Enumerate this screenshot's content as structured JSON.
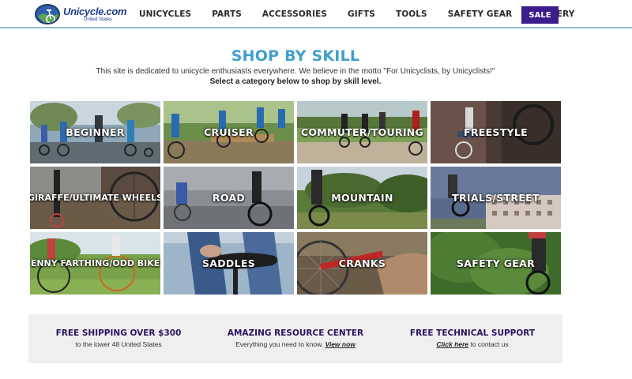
{
  "logo": {
    "name": "Unicycle.com",
    "sub": "United States"
  },
  "nav": {
    "items": [
      {
        "label": "UNICYCLES"
      },
      {
        "label": "PARTS"
      },
      {
        "label": "ACCESSORIES"
      },
      {
        "label": "GIFTS"
      },
      {
        "label": "TOOLS"
      },
      {
        "label": "SAFETY GEAR"
      },
      {
        "label": "GALLERY"
      }
    ],
    "sale_label": "SALE"
  },
  "intro": {
    "title": "SHOP BY SKILL",
    "line1": "This site is dedicated to unicycle enthusiasts everywhere. We believe in the motto \"For Unicyclists, by Unicyclists!\"",
    "line2": "Select a category below to shop by skill level."
  },
  "categories": [
    {
      "label": "BEGINNER"
    },
    {
      "label": "CRUISER"
    },
    {
      "label": "COMMUTER/TOURING"
    },
    {
      "label": "FREESTYLE"
    },
    {
      "label": "GIRAFFE/ULTIMATE WHEELS"
    },
    {
      "label": "ROAD"
    },
    {
      "label": "MOUNTAIN"
    },
    {
      "label": "TRIALS/STREET"
    },
    {
      "label": "PENNY FARTHING/ODD BIKES"
    },
    {
      "label": "SADDLES"
    },
    {
      "label": "CRANKS"
    },
    {
      "label": "SAFETY GEAR"
    }
  ],
  "features": [
    {
      "title": "FREE SHIPPING OVER $300",
      "sub": "to the lower 48 United States"
    },
    {
      "title": "AMAZING RESOURCE CENTER",
      "sub_pre": "Everything you need to know. ",
      "link": "View now"
    },
    {
      "title": "FREE TECHNICAL SUPPORT",
      "link": "Click here",
      "sub_post": " to contact us"
    }
  ],
  "colors": {
    "accent": "#3fa0cf",
    "sale_bg": "#3d1c8c",
    "feature_title": "#2a1460",
    "band_bg": "#efefef"
  }
}
